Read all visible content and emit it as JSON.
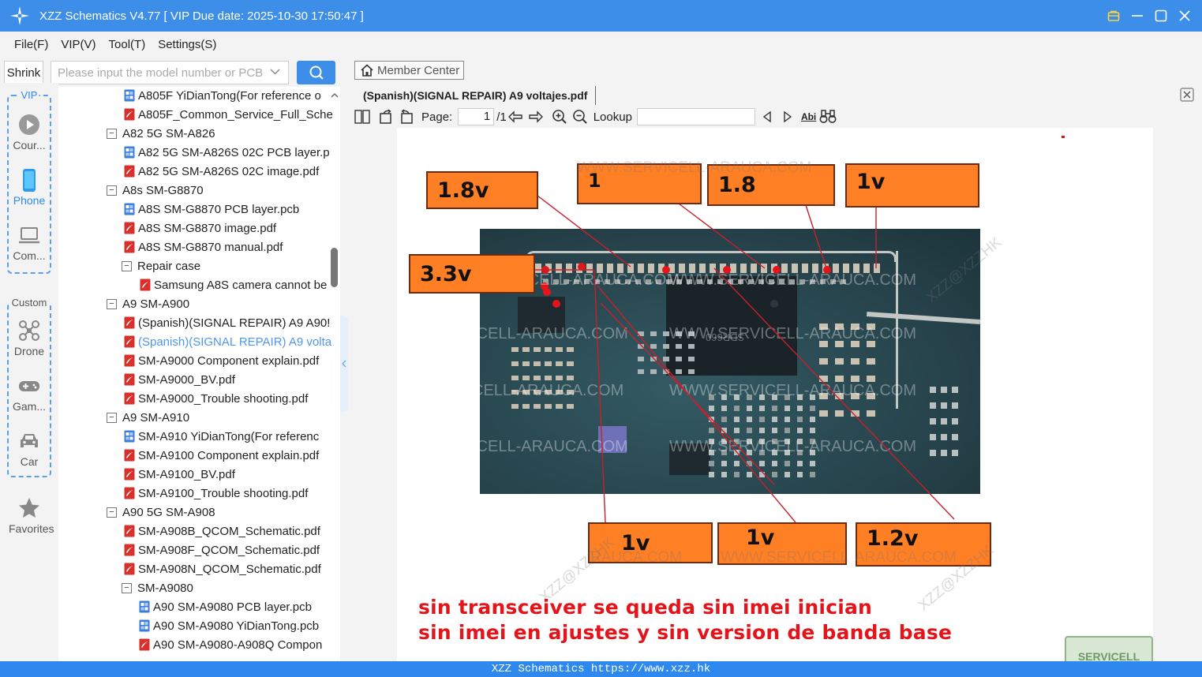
{
  "titlebar": {
    "title": "XZZ Schematics V4.77 [ VIP Due date: 2025-10-30 17:50:47 ]"
  },
  "menu": [
    "File(F)",
    "VIP(V)",
    "Tool(T)",
    "Settings(S)"
  ],
  "search": {
    "shrink_label": "Shrink",
    "placeholder": "Please input the model number or PCB"
  },
  "rail": {
    "vip_label": "VIP",
    "custom_label": "Custom",
    "items": {
      "course": "Cour...",
      "phone": "Phone",
      "computer": "Com...",
      "drone": "Drone",
      "game": "Gam...",
      "car": "Car",
      "favorites": "Favorites"
    }
  },
  "tree": [
    {
      "label": "A805F YiDianTong(For reference o",
      "icon": "pcb-file-icon"
    },
    {
      "label": "A805F_Common_Service_Full_Sche",
      "icon": "pdf-file-icon"
    },
    {
      "label": "A82 5G SM-A826",
      "icon": "folder"
    },
    {
      "label": "A82 5G SM-A826S 02C PCB layer.p",
      "icon": "pcb-file-icon"
    },
    {
      "label": "A82 5G SM-A826S 02C image.pdf",
      "icon": "pdf-file-icon"
    },
    {
      "label": "A8s SM-G8870",
      "icon": "folder"
    },
    {
      "label": "A8S SM-G8870 PCB layer.pcb",
      "icon": "pcb-file-icon"
    },
    {
      "label": "A8S SM-G8870 image.pdf",
      "icon": "pdf-file-icon"
    },
    {
      "label": "A8S SM-G8870 manual.pdf",
      "icon": "pdf-file-icon"
    },
    {
      "label": "Repair case",
      "icon": "folder"
    },
    {
      "label": "Samsung A8S camera cannot be",
      "icon": "pdf-file-icon"
    },
    {
      "label": "A9 SM-A900",
      "icon": "folder"
    },
    {
      "label": "(Spanish)(SIGNAL REPAIR) A9 A90!",
      "icon": "pdf-file-icon"
    },
    {
      "label": "(Spanish)(SIGNAL REPAIR) A9 volta",
      "icon": "pdf-file-icon"
    },
    {
      "label": "SM-A9000 Component explain.pdf",
      "icon": "pdf-file-icon"
    },
    {
      "label": "SM-A9000_BV.pdf",
      "icon": "pdf-file-icon"
    },
    {
      "label": "SM-A9000_Trouble shooting.pdf",
      "icon": "pdf-file-icon"
    },
    {
      "label": "A9 SM-A910",
      "icon": "folder"
    },
    {
      "label": "SM-A910 YiDianTong(For referenc",
      "icon": "pcb-file-icon"
    },
    {
      "label": "SM-A9100 Component explain.pdf",
      "icon": "pdf-file-icon"
    },
    {
      "label": "SM-A9100_BV.pdf",
      "icon": "pdf-file-icon"
    },
    {
      "label": "SM-A9100_Trouble shooting.pdf",
      "icon": "pdf-file-icon"
    },
    {
      "label": "A90 5G SM-A908",
      "icon": "folder"
    },
    {
      "label": "SM-A908B_QCOM_Schematic.pdf",
      "icon": "pdf-file-icon"
    },
    {
      "label": "SM-A908F_QCOM_Schematic.pdf",
      "icon": "pdf-file-icon"
    },
    {
      "label": "SM-A908N_QCOM_Schematic.pdf",
      "icon": "pdf-file-icon"
    },
    {
      "label": "SM-A9080",
      "icon": "folder"
    },
    {
      "label": "A90 SM-A9080 PCB layer.pcb",
      "icon": "pcb-file-icon"
    },
    {
      "label": "A90 SM-A9080 YiDianTong.pcb",
      "icon": "pcb-file-icon"
    },
    {
      "label": "A90 SM-A9080-A908Q Compon",
      "icon": "pdf-file-icon"
    }
  ],
  "viewer": {
    "member_center": "Member Center",
    "tab_title": "(Spanish)(SIGNAL REPAIR) A9 voltajes.pdf",
    "page_label": "Page:",
    "page_current": "1",
    "page_total": "/1",
    "lookup_label": "Lookup",
    "abc_label": "Abi"
  },
  "document": {
    "voltage_labels": [
      "1.8v",
      "1",
      "1.8",
      "1v",
      "3.3v",
      "1v",
      "1v",
      "1.2v"
    ],
    "watermark": "WWW.SERVICELL-ARAUCA.COM",
    "watermark_partial": [
      "ICELL-ARAUCA.COM",
      "CELL-ARAUCA.COM",
      "WWW.SERVICELL",
      "ARAUCA.COM",
      "RAUCA.COM"
    ],
    "watermark_xzz": "XZZ@XZZHK",
    "chip_marking": "SDR660",
    "note_line1": "sin transceiver se queda sin imei inician",
    "note_line2": "sin imei en ajustes y sin version de banda base",
    "stamp_text": "SERVICELL"
  },
  "footer": {
    "text": "XZZ Schematics https://www.xzz.hk"
  },
  "colors": {
    "accent": "#3d8ee8",
    "label_orange": "#ff7f24",
    "note_red": "#e4141b",
    "pcb_green": "#2c4a54"
  }
}
